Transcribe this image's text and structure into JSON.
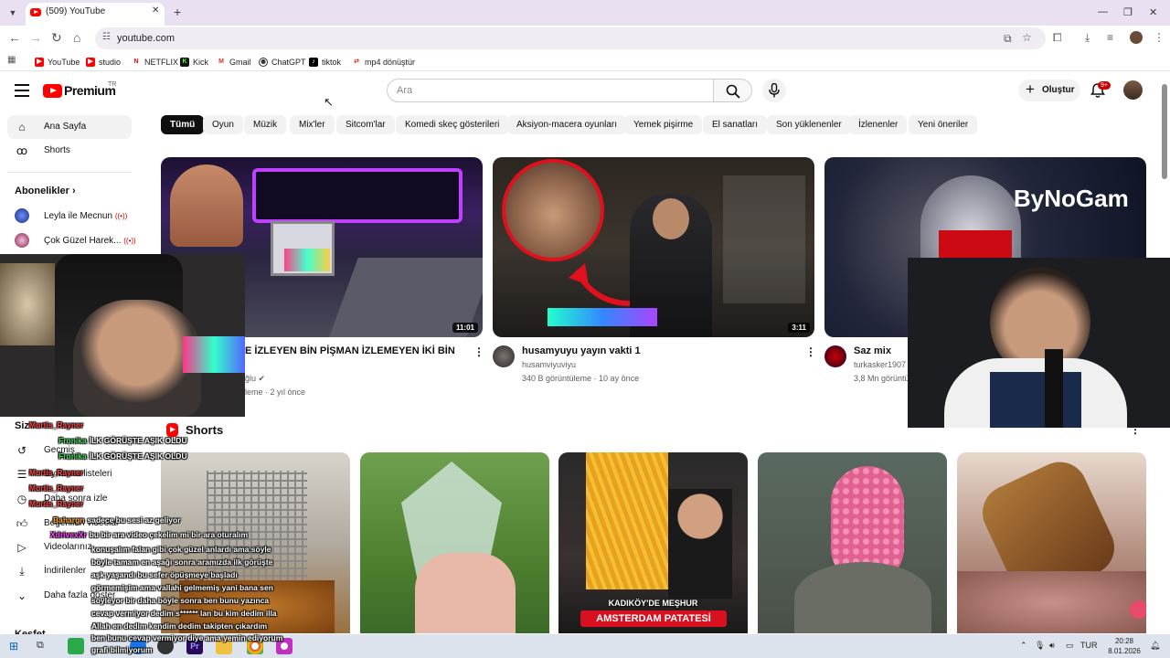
{
  "browser": {
    "tab_title": "(509) YouTube",
    "url": "youtube.com",
    "bookmarks": [
      "YouTube",
      "studio",
      "NETFLIX",
      "Kick",
      "Gmail",
      "ChatGPT",
      "tiktok",
      "mp4 dönüştür"
    ]
  },
  "header": {
    "logo_text": "Premium",
    "region": "TR",
    "search_placeholder": "Ara",
    "create_label": "Oluştur",
    "notification_count": "9+"
  },
  "sidebar": {
    "top": [
      {
        "label": "Ana Sayfa",
        "icon": "home-icon",
        "active": true
      },
      {
        "label": "Shorts",
        "icon": "shorts-icon",
        "active": false
      }
    ],
    "subscriptions_title": "Abonelikler",
    "subscriptions": [
      {
        "name": "Leyla ile Mecnun"
      },
      {
        "name": "Çok Güzel Harek..."
      }
    ],
    "you_title": "Siz",
    "you_items": [
      "Geçmiş",
      "Oynatma listeleri",
      "Daha sonra izle",
      "Beğenilen videolar",
      "Videolarınız",
      "İndirilenler",
      "Daha fazla göster"
    ],
    "explore_title": "Keşfet"
  },
  "chips": [
    "Tümü",
    "Oyun",
    "Müzik",
    "Mix'ler",
    "Sitcom'lar",
    "Komedi skeç gösterileri",
    "Aksiyon-macera oyunları",
    "Yemek pişirme",
    "El sanatları",
    "Son yüklenenler",
    "İzlenenler",
    "Yeni öneriler"
  ],
  "videos": [
    {
      "title": "E İZLEYEN BİN PİŞMAN İZLEMEYEN İKİ BİN",
      "channel": "ğlu",
      "meta": "leme · 2 yıl önce",
      "duration": "11:01"
    },
    {
      "title": "husamyuyu yayın vakti 1",
      "channel": "husamviyuviyu",
      "meta": "340 B görüntüleme · 10 ay önce",
      "duration": "3:11"
    },
    {
      "title": "Saz mix",
      "channel": "turkasker1907",
      "meta": "3,8 Mn görüntü",
      "thumb_text": "ByNoGam"
    }
  ],
  "shorts": {
    "title": "Shorts",
    "items": [
      {
        "caption": ""
      },
      {
        "caption": ""
      },
      {
        "caption_top": "KADIKÖY'DE MEŞHUR",
        "caption_bottom": "AMSTERDAM PATATESİ"
      },
      {
        "caption": ""
      },
      {
        "caption": ""
      }
    ]
  },
  "chat": [
    {
      "user": "Mortis_Rayner",
      "text": "",
      "color": "#ff4444"
    },
    {
      "user": "Fronika",
      "text": "İLK GÖRÜŞTE AŞIK OLDU",
      "color": "#44dd66"
    },
    {
      "user": "Fronika",
      "text": "İLK GÖRÜŞTE AŞIK OLDU",
      "color": "#44dd66"
    },
    {
      "user": "Mortis_Rayner",
      "text": "",
      "color": "#ff4444"
    },
    {
      "user": "Mortis_Rayner",
      "text": "",
      "color": "#ff4444"
    },
    {
      "user": "Mortis_Rayner",
      "text": "",
      "color": "#ff4444"
    },
    {
      "user": "Bahargn",
      "text": "sadece bu sesi az geliyor",
      "color": "#ffaa33"
    },
    {
      "user": "XdrivexXr",
      "text": "bu bir ara video çekelim mi bir ara oturalım",
      "color": "#ff44ff"
    },
    {
      "user": "",
      "text": "konuşalım falan gibi çok güzel anlardı ama söyle",
      "color": "#ffffff"
    },
    {
      "user": "",
      "text": "böyle tamam en aşağı sonra aramızda ilk görüşte",
      "color": "#ffffff"
    },
    {
      "user": "",
      "text": "aşk yaşandı bu sefer öpüşmeye başladı",
      "color": "#ffffff"
    },
    {
      "user": "",
      "text": "görmemişim ama vallahi gelmemiş yani bana sen",
      "color": "#ffffff"
    },
    {
      "user": "",
      "text": "söyleyor bir daha böyle sonra ben bunu yazınca",
      "color": "#ffffff"
    },
    {
      "user": "",
      "text": "cevap vermiyor dedim s****** lan bu kim dedim illa",
      "color": "#ffffff"
    },
    {
      "user": "",
      "text": "Allah en dedim kendim dedim takipten çıkardım",
      "color": "#ffffff"
    },
    {
      "user": "",
      "text": "ben bunu cevap vermiyor diye ama yemin ediyorum",
      "color": "#ffffff"
    },
    {
      "user": "",
      "text": "grafi bilmiyorum",
      "color": "#ffffff"
    }
  ],
  "taskbar": {
    "lang": "TUR",
    "time": "20:28",
    "date": "8.01.2026"
  }
}
